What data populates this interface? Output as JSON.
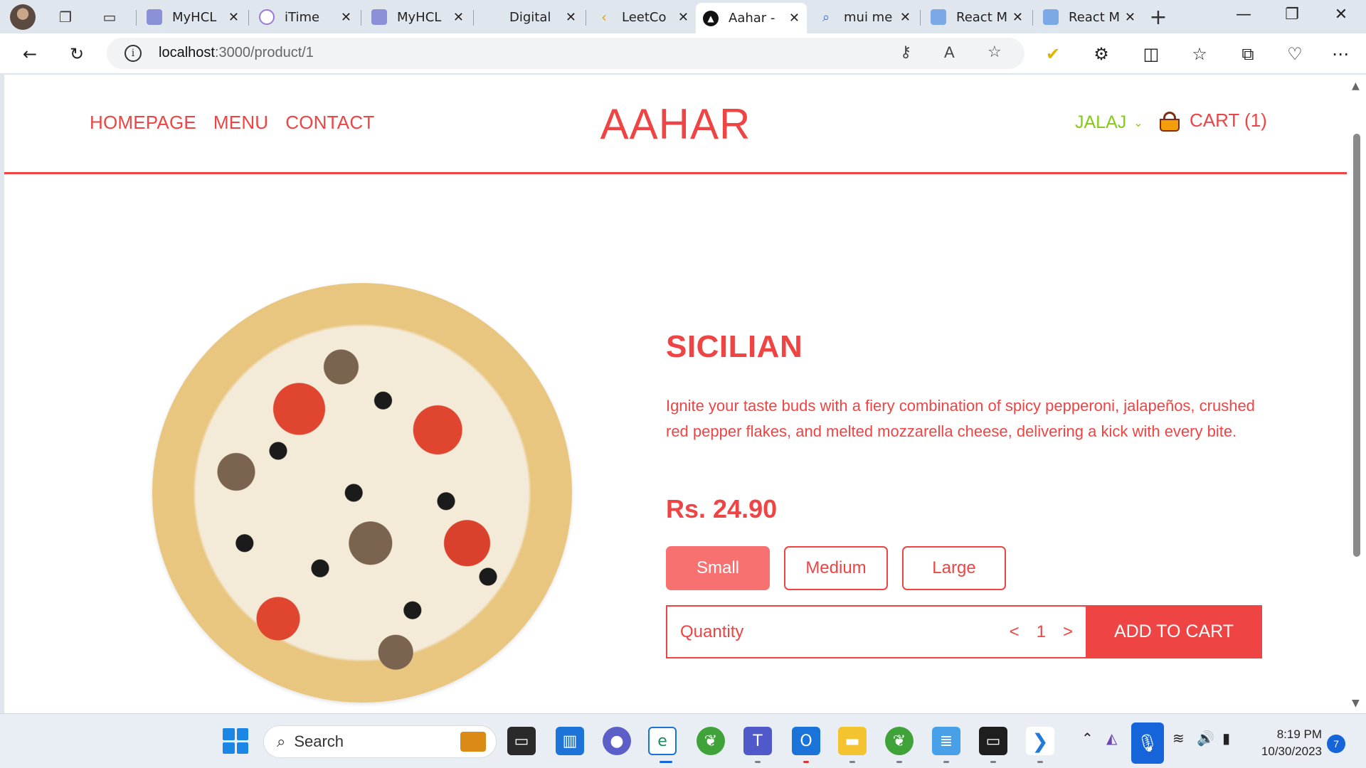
{
  "browser": {
    "tabs": [
      {
        "title": "MyHCL",
        "active": false
      },
      {
        "title": "iTime",
        "active": false
      },
      {
        "title": "MyHCL",
        "active": false
      },
      {
        "title": "Digital",
        "active": false
      },
      {
        "title": "LeetCo",
        "active": false
      },
      {
        "title": "Aahar -",
        "active": true
      },
      {
        "title": "mui me",
        "active": false
      },
      {
        "title": "React M",
        "active": false
      },
      {
        "title": "React M",
        "active": false
      }
    ],
    "url_host": "localhost",
    "url_path": ":3000/product/1"
  },
  "site": {
    "nav": [
      "HOMEPAGE",
      "MENU",
      "CONTACT"
    ],
    "logo": "AAHAR",
    "user": "JALAJ",
    "cart_label": "CART (1)"
  },
  "product": {
    "name": "SICILIAN",
    "description": "Ignite your taste buds with a fiery combination of spicy pepperoni, jalapeños, crushed red pepper flakes, and melted mozzarella cheese, delivering a kick with every bite.",
    "price": "Rs. 24.90",
    "sizes": [
      "Small",
      "Medium",
      "Large"
    ],
    "selected_size": "Small",
    "quantity_label": "Quantity",
    "quantity": "1",
    "decrement": "<",
    "increment": ">",
    "add_to_cart": "ADD TO CART"
  },
  "colors": {
    "accent": "#ef4444",
    "user": "#84cc16"
  },
  "taskbar": {
    "search_label": "Search",
    "time": "8:19 PM",
    "date": "10/30/2023",
    "notifications": "7"
  }
}
